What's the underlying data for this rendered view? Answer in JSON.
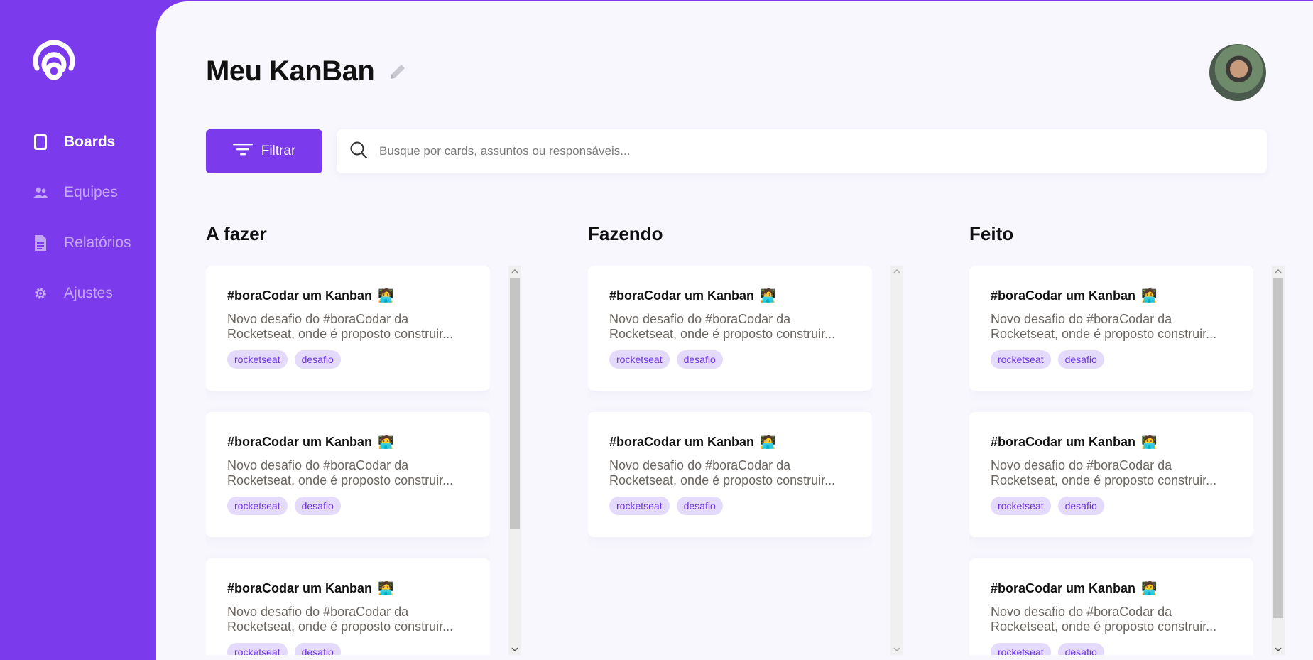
{
  "sidebar": {
    "items": [
      {
        "label": "Boards",
        "icon": "board-icon",
        "active": true
      },
      {
        "label": "Equipes",
        "icon": "team-icon",
        "active": false
      },
      {
        "label": "Relatórios",
        "icon": "report-icon",
        "active": false
      },
      {
        "label": "Ajustes",
        "icon": "gear-icon",
        "active": false
      }
    ]
  },
  "header": {
    "title": "Meu KanBan"
  },
  "toolbar": {
    "filter_label": "Filtrar",
    "search_placeholder": "Busque por cards, assuntos ou responsáveis..."
  },
  "columns": [
    {
      "title": "A fazer",
      "cards": [
        {
          "title": "#boraCodar um Kanban",
          "emoji": "🧑‍💻",
          "description": "Novo desafio do #boraCodar da Rocketseat, onde é proposto construir...",
          "tags": [
            "rocketseat",
            "desafio"
          ]
        },
        {
          "title": "#boraCodar um Kanban",
          "emoji": "🧑‍💻",
          "description": "Novo desafio do #boraCodar da Rocketseat, onde é proposto construir...",
          "tags": [
            "rocketseat",
            "desafio"
          ]
        },
        {
          "title": "#boraCodar um Kanban",
          "emoji": "🧑‍💻",
          "description": "Novo desafio do #boraCodar da Rocketseat, onde é proposto construir...",
          "tags": [
            "rocketseat",
            "desafio"
          ]
        }
      ]
    },
    {
      "title": "Fazendo",
      "cards": [
        {
          "title": "#boraCodar um Kanban",
          "emoji": "🧑‍💻",
          "description": "Novo desafio do #boraCodar da Rocketseat, onde é proposto construir...",
          "tags": [
            "rocketseat",
            "desafio"
          ]
        },
        {
          "title": "#boraCodar um Kanban",
          "emoji": "🧑‍💻",
          "description": "Novo desafio do #boraCodar da Rocketseat, onde é proposto construir...",
          "tags": [
            "rocketseat",
            "desafio"
          ]
        }
      ]
    },
    {
      "title": "Feito",
      "cards": [
        {
          "title": "#boraCodar um Kanban",
          "emoji": "🧑‍💻",
          "description": "Novo desafio do #boraCodar da Rocketseat, onde é proposto construir...",
          "tags": [
            "rocketseat",
            "desafio"
          ]
        },
        {
          "title": "#boraCodar um Kanban",
          "emoji": "🧑‍💻",
          "description": "Novo desafio do #boraCodar da Rocketseat, onde é proposto construir...",
          "tags": [
            "rocketseat",
            "desafio"
          ]
        },
        {
          "title": "#boraCodar um Kanban",
          "emoji": "🧑‍💻",
          "description": "Novo desafio do #boraCodar da Rocketseat, onde é proposto construir...",
          "tags": [
            "rocketseat",
            "desafio"
          ]
        }
      ]
    }
  ],
  "colors": {
    "accent": "#7c3aed",
    "background": "#f8f7fd",
    "tag_bg": "#e4dafc",
    "tag_text": "#6d34e0"
  }
}
